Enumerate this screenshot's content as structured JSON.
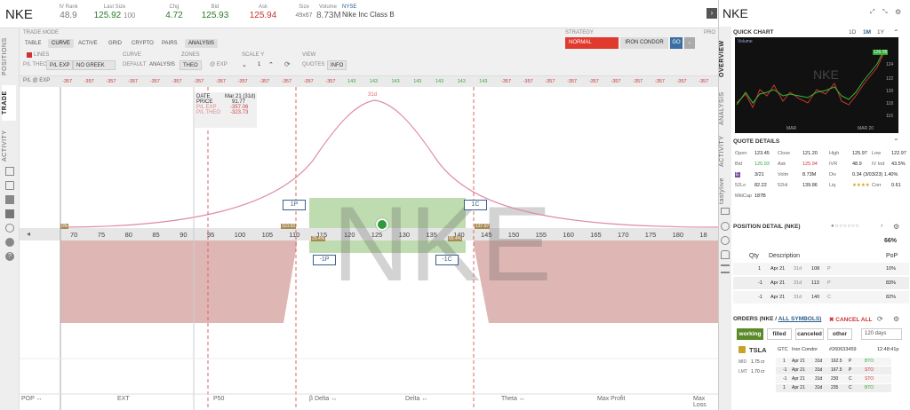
{
  "header": {
    "symbol": "NKE",
    "iv_rank_label": "IV Rank",
    "iv_rank": "48.9",
    "last_label": "Last Size",
    "last": "125.92",
    "last_size": "100",
    "chg_label": "Chg",
    "chg": "4.72",
    "bid_label": "Bid",
    "bid": "125.93",
    "ask_label": "Ask",
    "ask": "125.94",
    "size_label": "Size",
    "size": "49x67",
    "volume_label": "Volume",
    "volume": "8.73M",
    "exchange": "NYSE",
    "name": "Nike Inc Class B"
  },
  "left_tabs": [
    "POSITIONS",
    "TRADE",
    "ACTIVITY"
  ],
  "toolbar": {
    "trade_mode_label": "TRADE MODE",
    "modes": [
      "TABLE",
      "CURVE",
      "ACTIVE",
      "GRID",
      "CRYPTO",
      "PAIRS",
      "ANALYSIS"
    ],
    "lines_label": "LINES",
    "curve_label": "CURVE",
    "zones_label": "ZONES",
    "scale_label": "SCALE Y",
    "view_label": "VIEW",
    "pl_theo": "P/L THEO",
    "pl_exp": "P/L EXP",
    "no_greek": "NO GREEK",
    "default": "DEFAULT",
    "analysis": "ANALYSIS",
    "theo": "THEO",
    "at_exp": "@ EXP",
    "scale_val": "1",
    "quotes": "QUOTES",
    "info": "INFO",
    "strategy_label": "STRATEGY",
    "normal": "NORMAL",
    "iron_condor": "IRON CONDOR",
    "go": "GO",
    "pro": "PRO"
  },
  "chart": {
    "pl_label": "P/L @ EXP",
    "pl_values": [
      "-357",
      "-357",
      "-357",
      "-357",
      "-357",
      "-357",
      "-357",
      "-357",
      "-357",
      "-357",
      "-357",
      "-357",
      "-357",
      "143",
      "143",
      "143",
      "143",
      "143",
      "143",
      "143",
      "-357",
      "-357",
      "-357",
      "-357",
      "-357",
      "-357",
      "-357",
      "-357",
      "-357",
      "-357",
      "-357",
      "-357"
    ],
    "x_ticks": [
      "70",
      "75",
      "80",
      "85",
      "90",
      "95",
      "100",
      "105",
      "110",
      "115",
      "120",
      "125",
      "130",
      "135",
      "140",
      "145",
      "150",
      "155",
      "160",
      "165",
      "170",
      "175",
      "180",
      "18"
    ],
    "watermark": "NKE",
    "peak_label": "31d",
    "info_rows": [
      [
        "DATE",
        "Mar 21 (31d)"
      ],
      [
        "PRICE",
        "91.77"
      ],
      [
        "P/L EXP",
        "-357.06"
      ],
      [
        "P/L THEO",
        "-323.73"
      ]
    ],
    "legs": [
      "1P",
      "-1P",
      "-1C",
      "1C"
    ],
    "be_labels": [
      "110.93",
      "25.4%",
      "65.4%",
      "137.97"
    ],
    "bottom_metrics": [
      "POP ↔",
      "EXT",
      "P50",
      "β Delta ↔",
      "Delta ↔",
      "Theta ↔",
      "Max Profit",
      "Max Loss"
    ]
  },
  "panel": {
    "symbol": "NKE",
    "tabs": [
      "OVERVIEW",
      "ANALYSIS",
      "ACTIVITY",
      "tastylive"
    ],
    "quick_chart": "QUICK CHART",
    "ranges": [
      "1D",
      "1M",
      "1Y"
    ],
    "chart_volume": "Volume",
    "chart_price": "126.95",
    "chart_axis": [
      "124",
      "122",
      "120",
      "118",
      "116"
    ],
    "chart_dates": [
      "MAR",
      "MAR 20"
    ],
    "quote_details": "QUOTE DETAILS",
    "quotes": [
      [
        "Open",
        "123.45",
        "Close",
        "121.20",
        "High",
        "125.97",
        "Low",
        "122.97"
      ],
      [
        "Bid",
        "125.93",
        "Ask",
        "125.94",
        "IVR",
        "48.9",
        "IV Ind",
        "43.5%"
      ],
      [
        "E",
        "3/21",
        "Volm",
        "8.73M",
        "Div",
        "0.34 (3/03/23) 1.40%"
      ],
      [
        "52Lo",
        "82.22",
        "52Hi",
        "139.86",
        "Liq",
        "★★★★",
        "Corr",
        "0.61"
      ],
      [
        "MktCap",
        "187B"
      ]
    ],
    "position_detail": "POSITION DETAIL (NKE)",
    "pop_pct": "66%",
    "pos_headers": [
      "Qty",
      "Description",
      "PoP"
    ],
    "positions": [
      [
        "1",
        "Apr 21",
        "31d",
        "108",
        "P",
        "10%"
      ],
      [
        "-1",
        "Apr 21",
        "31d",
        "113",
        "P",
        "83%"
      ],
      [
        "-1",
        "Apr 21",
        "31d",
        "140",
        "C",
        "82%"
      ]
    ],
    "orders_label": "ORDERS (NKE /",
    "all_symbols": "ALL SYMBOLS)",
    "cancel_all": "✖ CANCEL ALL",
    "filters": [
      "working",
      "filled",
      "canceled",
      "other"
    ],
    "days": "120 days",
    "order": {
      "symbol": "TSLA",
      "tif": "GTC",
      "strategy": "Iron Condor",
      "id": "#260633459",
      "time": "12:48:41p",
      "mid_label": "MID",
      "mid": "1.75 cr",
      "lmt_label": "LMT",
      "lmt": "1.70 cr",
      "legs": [
        [
          "1",
          "Apr 21",
          "31d",
          "162.5",
          "P",
          "BTO"
        ],
        [
          "-1",
          "Apr 21",
          "31d",
          "167.5",
          "P",
          "STO"
        ],
        [
          "-1",
          "Apr 21",
          "31d",
          "230",
          "C",
          "STO"
        ],
        [
          "1",
          "Apr 21",
          "31d",
          "235",
          "C",
          "BTO"
        ]
      ]
    }
  },
  "colors": {
    "accent": "#2a5c8a",
    "loss": "#d9a8a8",
    "profit": "#b9dca9",
    "normal": "#e03a2e",
    "go": "#3a6ea5"
  }
}
